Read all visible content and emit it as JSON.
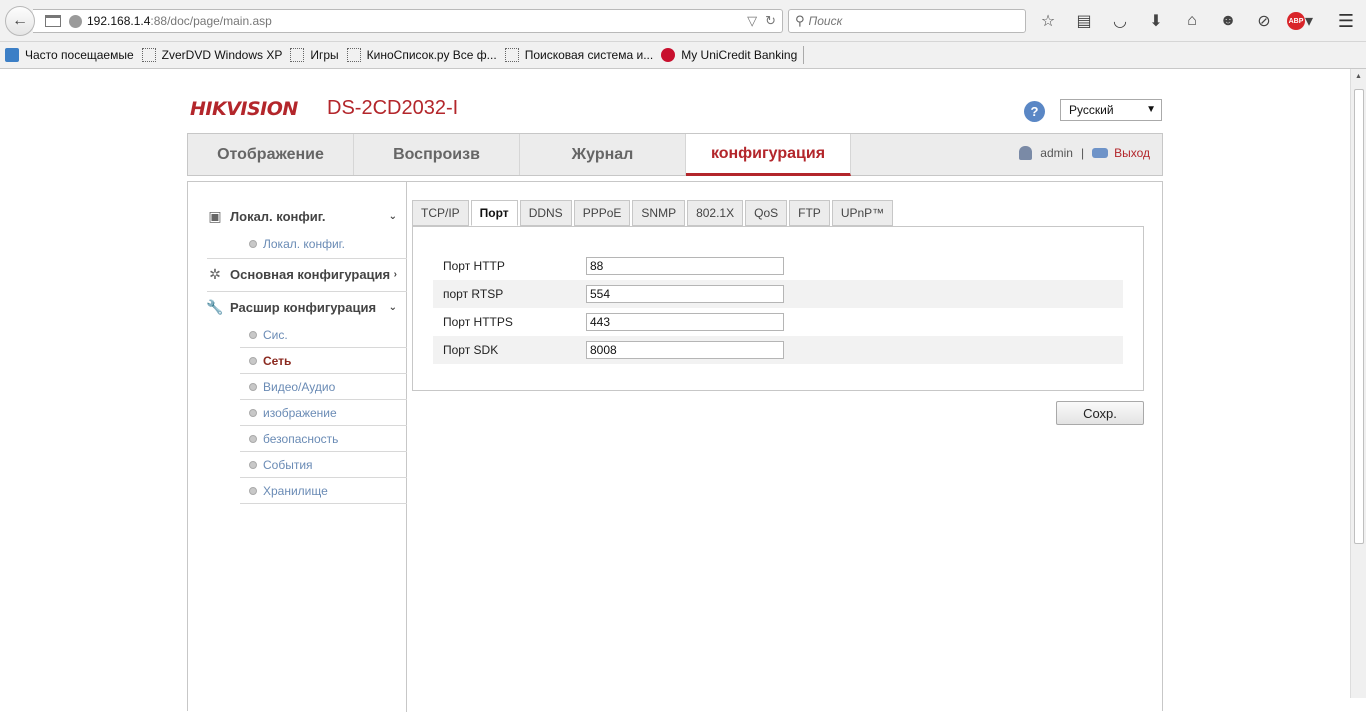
{
  "browser": {
    "url_host": "192.168.1.4",
    "url_path": ":88/doc/page/main.asp",
    "search_placeholder": "Поиск",
    "abp_label": "ABP",
    "bookmarks": [
      {
        "label": "Часто посещаемые",
        "icon": "bookmarks-folder-icon"
      },
      {
        "label": "ZverDVD Windows XP",
        "icon": "page-icon"
      },
      {
        "label": "Игры",
        "icon": "page-icon"
      },
      {
        "label": "КиноСписок.ру Все ф...",
        "icon": "page-icon"
      },
      {
        "label": "Поисковая система и...",
        "icon": "page-icon"
      },
      {
        "label": "My UniCredit Banking",
        "icon": "unicredit-icon"
      }
    ]
  },
  "header": {
    "brand": "HIKVISION",
    "model": "DS-2CD2032-I",
    "help": "?",
    "language": "Русский"
  },
  "nav": {
    "tabs": [
      "Отображение",
      "Воспроизв",
      "Журнал",
      "конфигурация"
    ],
    "active_index": 3,
    "user": "admin",
    "separator": "|",
    "logout": "Выход"
  },
  "sidebar": {
    "groups": [
      {
        "label": "Локал. конфиг.",
        "icon": "monitor-icon",
        "items": [
          "Локал. конфиг."
        ]
      },
      {
        "label": "Основная конфигурация",
        "icon": "gear-icon",
        "items": []
      },
      {
        "label": "Расшир конфигурация",
        "icon": "wrench-icon",
        "items": [
          "Сис.",
          "Сеть",
          "Видео/Аудио",
          "изображение",
          "безопасность",
          "События",
          "Хранилище"
        ]
      }
    ],
    "active_item": "Сеть"
  },
  "tabs": [
    "TCP/IP",
    "Порт",
    "DDNS",
    "PPPoE",
    "SNMP",
    "802.1X",
    "QoS",
    "FTP",
    "UPnP™"
  ],
  "active_tab": "Порт",
  "ports": [
    {
      "label": "Порт HTTP",
      "value": "88"
    },
    {
      "label": "порт RTSP",
      "value": "554"
    },
    {
      "label": "Порт HTTPS",
      "value": "443"
    },
    {
      "label": "Порт SDK",
      "value": "8008"
    }
  ],
  "save_label": "Сохр."
}
